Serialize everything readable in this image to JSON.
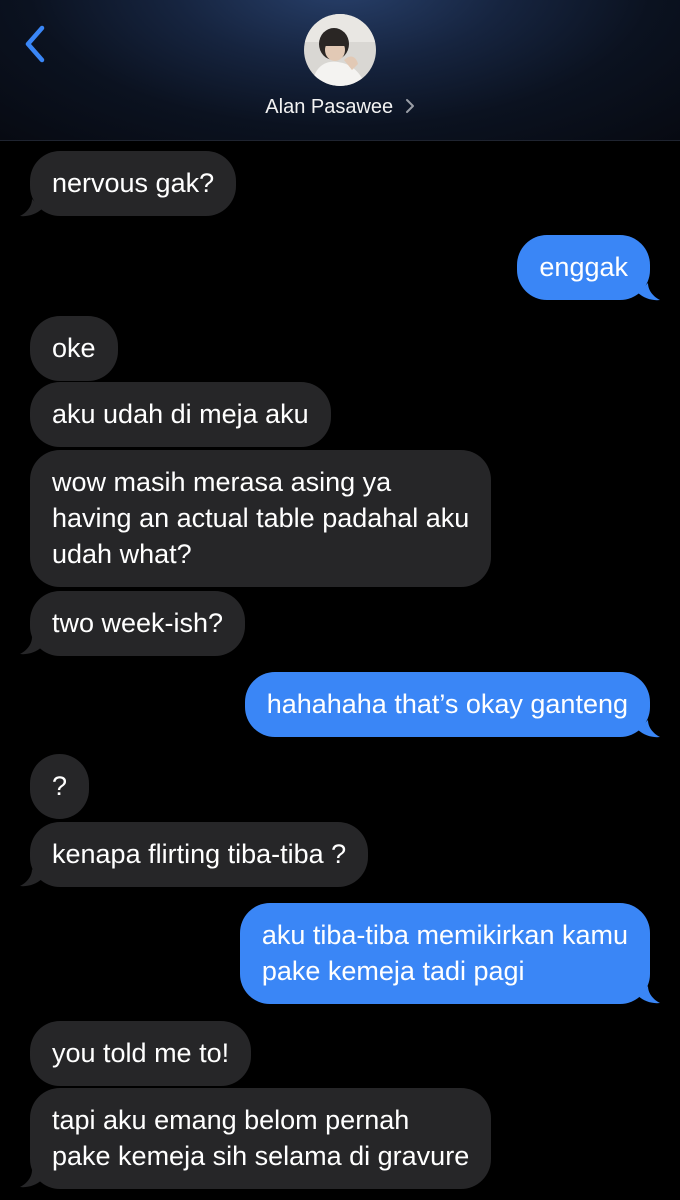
{
  "header": {
    "contact_name": "Alan Pasawee",
    "accent_color": "#3a86f6"
  },
  "icons": {
    "back": "chevron-left-icon",
    "contact_details": "chevron-right-icon"
  },
  "colors": {
    "incoming_bubble": "#262628",
    "outgoing_bubble": "#3a86f6",
    "background": "#000000"
  },
  "messages": [
    {
      "from": "them",
      "text": "nervous gak?"
    },
    {
      "from": "me",
      "text": "enggak"
    },
    {
      "from": "them",
      "text": "oke"
    },
    {
      "from": "them",
      "text": "aku udah di meja aku"
    },
    {
      "from": "them",
      "text": "wow masih merasa asing ya\nhaving an actual table padahal aku\nudah what?"
    },
    {
      "from": "them",
      "text": "two week-ish?"
    },
    {
      "from": "me",
      "text": "hahahaha that’s okay ganteng"
    },
    {
      "from": "them",
      "text": "?"
    },
    {
      "from": "them",
      "text": "kenapa flirting tiba-tiba ?"
    },
    {
      "from": "me",
      "text": "aku tiba-tiba memikirkan kamu\npake kemeja tadi pagi"
    },
    {
      "from": "them",
      "text": "you told me to!"
    },
    {
      "from": "them",
      "text": "tapi aku emang belom pernah\npake kemeja sih selama di gravure"
    }
  ]
}
